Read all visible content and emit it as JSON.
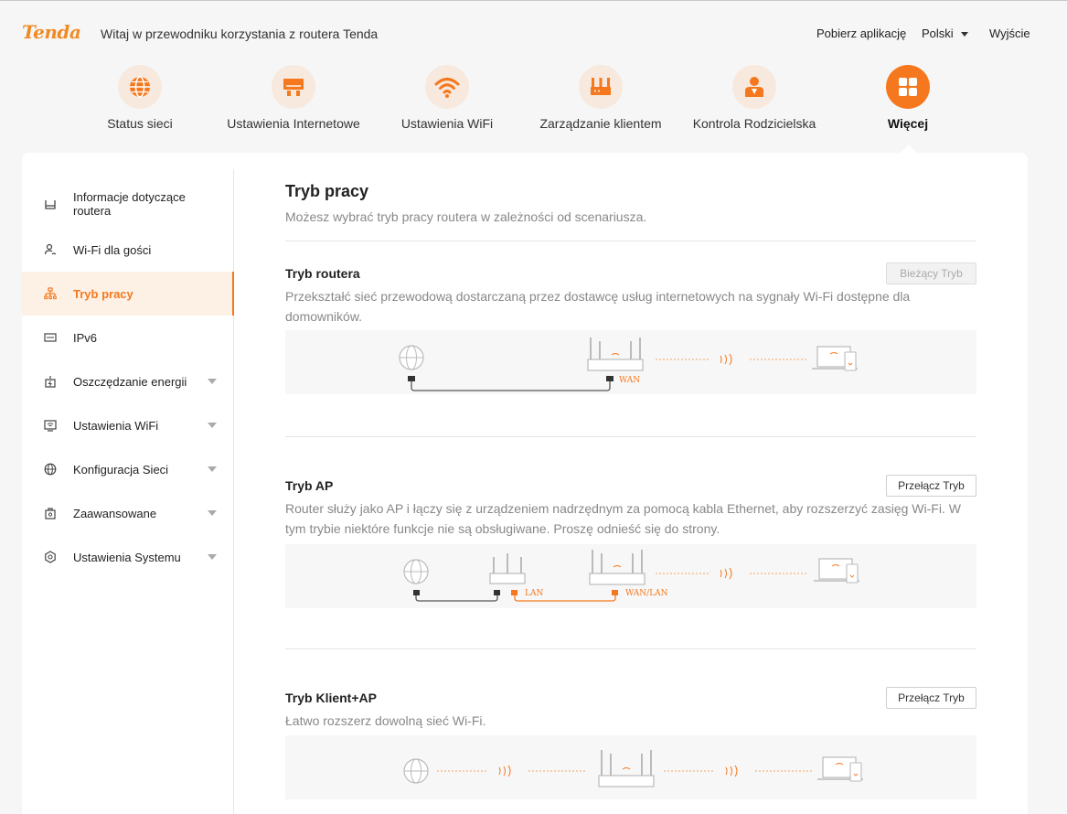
{
  "header": {
    "logo": "Tenda",
    "welcome": "Witaj w przewodniku korzystania z routera Tenda",
    "download_app": "Pobierz aplikację",
    "language": "Polski",
    "logout": "Wyjście"
  },
  "nav": [
    {
      "label": "Status sieci",
      "icon": "globe-icon"
    },
    {
      "label": "Ustawienia Internetowe",
      "icon": "internet-settings-icon"
    },
    {
      "label": "Ustawienia WiFi",
      "icon": "wifi-icon"
    },
    {
      "label": "Zarządzanie klientem",
      "icon": "router-icon"
    },
    {
      "label": "Kontrola Rodzicielska",
      "icon": "parental-control-icon"
    },
    {
      "label": "Więcej",
      "icon": "more-grid-icon",
      "active": true
    }
  ],
  "sidebar": [
    {
      "label": "Informacje dotyczące routera",
      "icon": "router-info-icon"
    },
    {
      "label": "Wi-Fi dla gości",
      "icon": "guest-wifi-icon"
    },
    {
      "label": "Tryb pracy",
      "icon": "work-mode-icon",
      "active": true
    },
    {
      "label": "IPv6",
      "icon": "ipv6-icon"
    },
    {
      "label": "Oszczędzanie energii",
      "icon": "energy-icon",
      "expandable": true
    },
    {
      "label": "Ustawienia WiFi",
      "icon": "wifi-settings-icon",
      "expandable": true
    },
    {
      "label": "Konfiguracja Sieci",
      "icon": "network-config-icon",
      "expandable": true
    },
    {
      "label": "Zaawansowane",
      "icon": "advanced-icon",
      "expandable": true
    },
    {
      "label": "Ustawienia Systemu",
      "icon": "system-settings-icon",
      "expandable": true
    }
  ],
  "main": {
    "title": "Tryb pracy",
    "subtitle": "Możesz wybrać tryb pracy routera w zależności od scenariusza.",
    "modes": [
      {
        "title": "Tryb routera",
        "desc": "Przekształć sieć przewodową dostarczaną przez dostawcę usług internetowych na sygnały Wi-Fi dostępne dla domowników.",
        "button": "Bieżący Tryb",
        "current": true,
        "labels": [
          "WAN"
        ]
      },
      {
        "title": "Tryb AP",
        "desc": "Router służy jako AP i łączy się z urządzeniem nadrzędnym za pomocą kabla Ethernet, aby rozszerzyć zasięg Wi-Fi. W tym trybie niektóre funkcje nie są obsługiwane. Proszę odnieść się do strony.",
        "button": "Przełącz Tryb",
        "current": false,
        "labels": [
          "LAN",
          "WAN/LAN"
        ]
      },
      {
        "title": "Tryb Klient+AP",
        "desc": "Łatwo rozszerz dowolną sieć Wi-Fi.",
        "button": "Przełącz Tryb",
        "current": false,
        "labels": []
      }
    ]
  },
  "colors": {
    "accent": "#f5781e",
    "nav_circle": "#f7e9dd",
    "active_bg": "#fdf1e6",
    "diagram_bg": "#f7f7f7"
  }
}
